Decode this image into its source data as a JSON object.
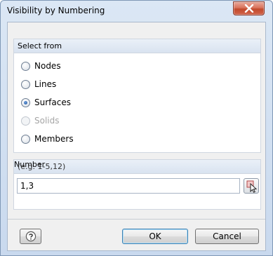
{
  "window": {
    "title": "Visibility by Numbering"
  },
  "select_from": {
    "heading": "Select from",
    "options": [
      {
        "label": "Nodes",
        "checked": false,
        "disabled": false
      },
      {
        "label": "Lines",
        "checked": false,
        "disabled": false
      },
      {
        "label": "Surfaces",
        "checked": true,
        "disabled": false
      },
      {
        "label": "Solids",
        "checked": false,
        "disabled": true
      },
      {
        "label": "Members",
        "checked": false,
        "disabled": false
      }
    ]
  },
  "number": {
    "label": "Number",
    "hint": "(e.g. 1-5,12)",
    "value": "1,3"
  },
  "buttons": {
    "ok_label": "OK",
    "cancel_label": "Cancel"
  },
  "icons": {
    "close": "close-icon",
    "pick": "pick-in-model-icon",
    "help": "help-icon"
  },
  "colors": {
    "close_button": "#c24a2c",
    "default_button_border": "#3c7fb1",
    "radio_selected": "#1c4f96"
  }
}
